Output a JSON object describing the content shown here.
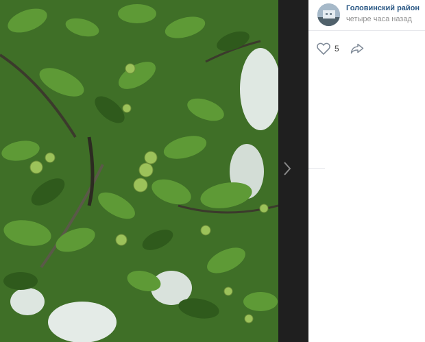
{
  "post": {
    "author": "Головинский район",
    "time": "четыре часа назад",
    "likes": "5"
  },
  "icons": {
    "avatar": "avatar-image",
    "like": "heart-icon",
    "share": "share-arrow-icon",
    "next": "chevron-right-icon"
  },
  "colors": {
    "author_link": "#2a5885",
    "muted_text": "#939393",
    "viewer_background": "#1f1f1f",
    "foliage": "#4a7a2e"
  }
}
